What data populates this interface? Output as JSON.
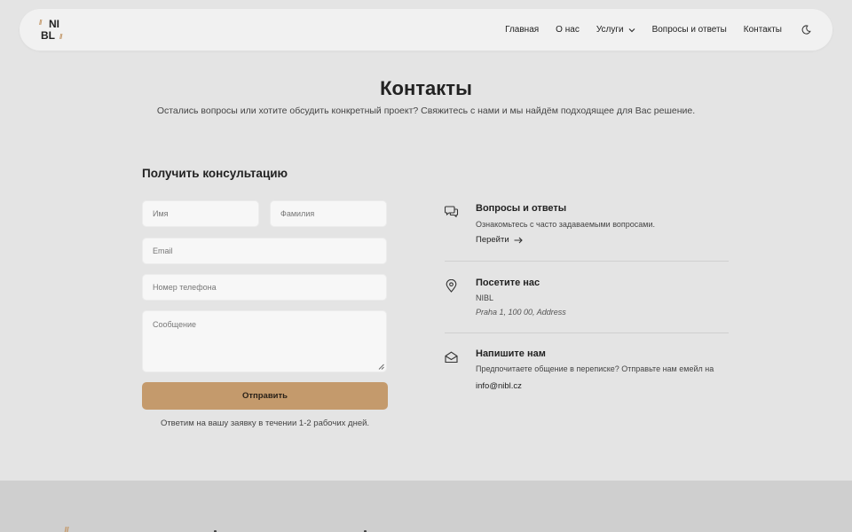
{
  "nav": {
    "logo": {
      "line1": "NI",
      "line2": "BL",
      "mark": "//"
    },
    "items": [
      {
        "label": "Главная"
      },
      {
        "label": "О нас"
      },
      {
        "label": "Услуги"
      },
      {
        "label": "Вопросы и ответы"
      },
      {
        "label": "Контакты"
      }
    ]
  },
  "header": {
    "title": "Контакты",
    "subtitle": "Остались вопросы или хотите обсудить конкретный проект? Свяжитесь с нами и мы найдём подходящее для Вас решение."
  },
  "form": {
    "title": "Получить консультацию",
    "name_placeholder": "Имя",
    "surname_placeholder": "Фамилия",
    "email_placeholder": "Email",
    "phone_placeholder": "Номер телефона",
    "message_placeholder": "Сообщение",
    "submit_label": "Отправить",
    "note": "Ответим на вашу заявку в течении 1-2 рабочих дней."
  },
  "contacts": {
    "faq": {
      "title": "Вопросы и ответы",
      "text": "Ознакомьтесь с часто задаваемыми вопросами.",
      "link": "Перейти"
    },
    "visit": {
      "title": "Посетите нас",
      "company": "NIBL",
      "address": "Praha 1, 100 00, Address"
    },
    "write": {
      "title": "Напишите нам",
      "text": "Предпочитаете общение в переписке? Отправьте нам емейл на",
      "email": "info@nibl.cz"
    }
  },
  "footer": {
    "mark": "//"
  },
  "colors": {
    "accent": "#c49a6c",
    "background": "#e4e4e4",
    "footer": "#cfcfcf"
  }
}
